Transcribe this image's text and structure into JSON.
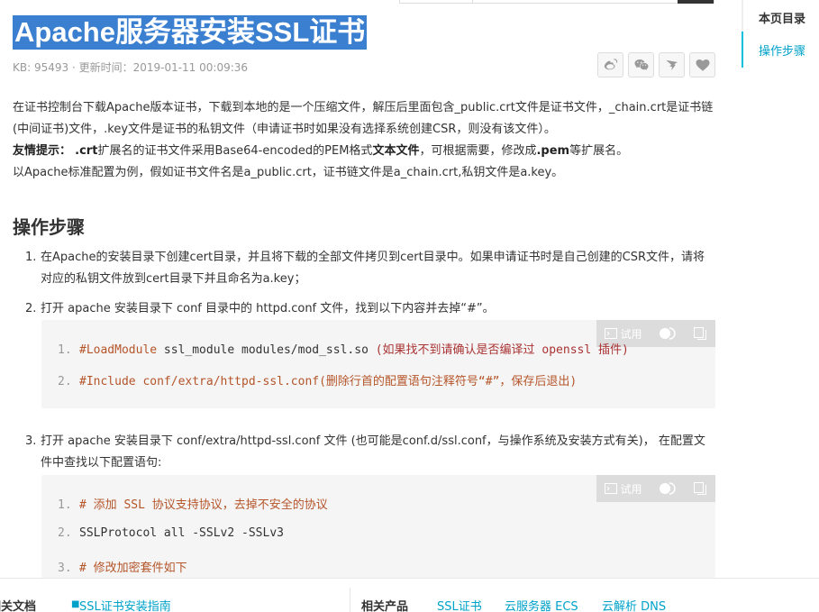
{
  "header": {
    "title": "Apache服务器安装SSL证书",
    "meta": "KB: 95493 · 更新时间：2019-01-11 00:09:36"
  },
  "share_icons": [
    "weibo-icon",
    "wechat-icon",
    "dingtalk-icon",
    "heart-icon"
  ],
  "intro": {
    "p1": "在证书控制台下载Apache版本证书，下载到本地的是一个压缩文件，解压后里面包含_public.crt文件是证书文件，_chain.crt是证书链(中间证书)文件，.key文件是证书的私钥文件（申请证书时如果没有选择系统创建CSR，则没有该文件）。",
    "tip_label": "友情提示：",
    "tip_a": ".crt",
    "tip_b": "扩展名的证书文件采用Base64-encoded的PEM格式",
    "tip_c": "文本文件",
    "tip_d": "，可根据需要，修改成",
    "tip_e": ".pem",
    "tip_f": "等扩展名。",
    "p3": "以Apache标准配置为例，假如证书文件名是a_public.crt，证书链文件是a_chain.crt,私钥文件是a.key。"
  },
  "section_title": "操作步骤",
  "steps": [
    {
      "num": "1.",
      "text": "在Apache的安装目录下创建cert目录，并且将下载的全部文件拷贝到cert目录中。如果申请证书时是自己创建的CSR文件，请将对应的私钥文件放到cert目录下并且命名为a.key；"
    },
    {
      "num": "2.",
      "text": "打开 apache 安装目录下 conf 目录中的 httpd.conf 文件，找到以下内容并去掉“#”。"
    },
    {
      "num": "3.",
      "text": "打开 apache 安装目录下 conf/extra/httpd-ssl.conf 文件 (也可能是conf.d/ssl.conf，与操作系统及安装方式有关)， 在配置文件中查找以下配置语句:"
    }
  ],
  "code1": {
    "try_label": "试用",
    "lines": [
      {
        "ln": "1.",
        "a": "#LoadModule",
        "b": " ssl_module modules/mod_ssl.so ",
        "c": "(如果找不到请确认是否编译过 openssl 插件)"
      },
      {
        "ln": "2.",
        "a": "#Include conf/extra/httpd-ssl.conf",
        "b": "",
        "c": "(删除行首的配置语句注释符号“#”，保存后退出)"
      }
    ]
  },
  "code2": {
    "try_label": "试用",
    "lines": [
      {
        "ln": "1.",
        "a": "# 添加 SSL 协议支持协议，去掉不安全的协议",
        "b": ""
      },
      {
        "ln": "2.",
        "a": "",
        "b": "SSLProtocol all -SSLv2 -SSLv3"
      },
      {
        "ln": "3.",
        "a": "# 修改加密套件如下",
        "b": ""
      }
    ]
  },
  "toc": {
    "title": "本页目录",
    "active": "操作步骤"
  },
  "footer": {
    "related_docs_label": "相关文档",
    "related_doc": "SSL证书安装指南",
    "related_products_label": "相关产品",
    "products": [
      "SSL证书",
      "云服务器 ECS",
      "云解析 DNS"
    ]
  }
}
